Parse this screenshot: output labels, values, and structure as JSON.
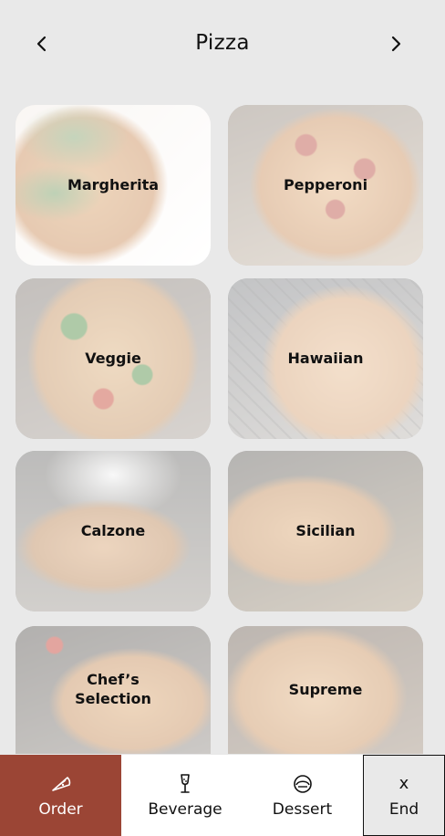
{
  "header": {
    "title": "Pizza",
    "prev_icon": "chevron-left-icon",
    "next_icon": "chevron-right-icon"
  },
  "menu": {
    "items": [
      {
        "label": "Margherita"
      },
      {
        "label": "Pepperoni"
      },
      {
        "label": "Veggie"
      },
      {
        "label": "Hawaiian"
      },
      {
        "label": "Calzone"
      },
      {
        "label": "Sicilian"
      },
      {
        "label": "Chef’s\nSelection"
      },
      {
        "label": "Supreme"
      }
    ]
  },
  "tabbar": {
    "order": {
      "label": "Order",
      "icon": "pizza-slice-icon",
      "color": "#9b4535"
    },
    "beverage": {
      "label": "Beverage",
      "icon": "champagne-glass-icon"
    },
    "dessert": {
      "label": "Dessert",
      "icon": "dessert-bowl-icon"
    },
    "end": {
      "label": "End",
      "icon_glyph": "x"
    }
  }
}
